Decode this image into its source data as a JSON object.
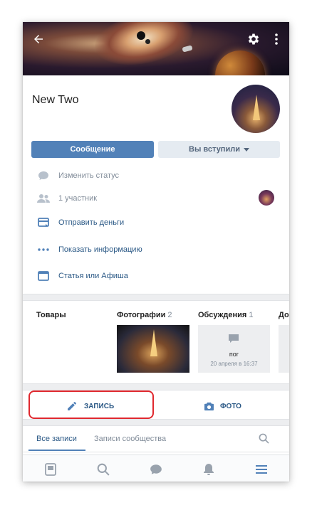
{
  "community": {
    "name": "New Two",
    "message_button": "Сообщение",
    "joined_button": "Вы вступили"
  },
  "info_rows": [
    {
      "icon": "chat-bubble-icon",
      "label": "Изменить статус"
    },
    {
      "icon": "people-icon",
      "label": "1 участник"
    },
    {
      "icon": "wallet-icon",
      "label": "Отправить деньги"
    },
    {
      "icon": "more-dots-icon",
      "label": "Показать информацию"
    },
    {
      "icon": "article-icon",
      "label": "Статья или Афиша"
    }
  ],
  "sections": {
    "goods": {
      "title": "Товары"
    },
    "photos": {
      "title": "Фотографии",
      "count": "2"
    },
    "discussions": {
      "title": "Обсуждения",
      "count": "1",
      "topic": "пог",
      "date": "20 апреля в 16:37"
    },
    "more": {
      "title": "До"
    }
  },
  "actions": {
    "post": "ЗАПИСЬ",
    "photo": "ФОТО"
  },
  "tabs": {
    "all": "Все записи",
    "community": "Записи сообщества"
  },
  "colors": {
    "accent": "#5181b8",
    "link": "#2a5885",
    "highlight": "#e0282e"
  }
}
